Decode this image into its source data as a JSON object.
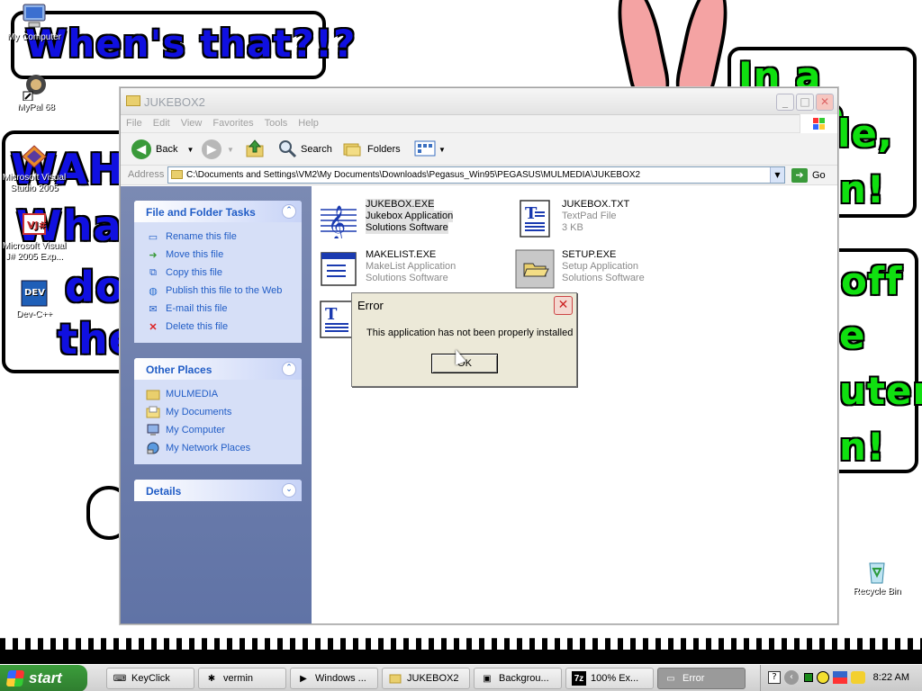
{
  "wallpaper": {
    "balloon_top_left": "When's that?!?",
    "balloon_left_lines": [
      "WAHU",
      "What",
      "do",
      "the"
    ],
    "balloon_right_lines": [
      "In a little",
      "le,",
      "n!"
    ],
    "balloon_right_bottom_lines": [
      "off",
      "e",
      "uter,",
      "n!"
    ]
  },
  "desktop_icons": [
    {
      "label": "My Computer"
    },
    {
      "label": "MyPal 68"
    },
    {
      "label": "Microsoft Visual Studio 2005"
    },
    {
      "label": "Microsoft Visual J# 2005 Exp..."
    },
    {
      "label": "Dev-C++"
    },
    {
      "label": "Recycle Bin"
    }
  ],
  "window": {
    "title": "JUKEBOX2",
    "menu": [
      "File",
      "Edit",
      "View",
      "Favorites",
      "Tools",
      "Help"
    ],
    "toolbar": {
      "back": "Back",
      "search": "Search",
      "folders": "Folders"
    },
    "address": {
      "label": "Address",
      "value": "C:\\Documents and Settings\\VM2\\My Documents\\Downloads\\Pegasus_Win95\\PEGASUS\\MULMEDIA\\JUKEBOX2",
      "go": "Go"
    },
    "file_tasks": {
      "title": "File and Folder Tasks",
      "items": [
        "Rename this file",
        "Move this file",
        "Copy this file",
        "Publish this file to the Web",
        "E-mail this file",
        "Delete this file"
      ]
    },
    "other_places": {
      "title": "Other Places",
      "items": [
        "MULMEDIA",
        "My Documents",
        "My Computer",
        "My Network Places"
      ]
    },
    "details": {
      "title": "Details"
    },
    "files": [
      {
        "name": "JUKEBOX.EXE",
        "line1": "Jukebox Application",
        "line2": "Solutions Software",
        "icon": "music-clef-icon"
      },
      {
        "name": "JUKEBOX.TXT",
        "line1": "TextPad File",
        "line2": "3 KB",
        "icon": "textpad-document-icon"
      },
      {
        "name": "MAKELIST.EXE",
        "line1": "MakeList Application",
        "line2": "Solutions Software",
        "icon": "window-app-icon"
      },
      {
        "name": "SETUP.EXE",
        "line1": "Setup Application",
        "line2": "Solutions Software",
        "icon": "open-folder-icon"
      },
      {
        "name": "",
        "line1": "",
        "line2": "",
        "icon": "textpad-document-icon"
      }
    ]
  },
  "dialog": {
    "title": "Error",
    "message": "This application has not been properly installed",
    "ok": "OK"
  },
  "taskbar": {
    "start": "start",
    "tasks": [
      {
        "label": "KeyClick"
      },
      {
        "label": "vermin"
      },
      {
        "label": "Windows ..."
      },
      {
        "label": "JUKEBOX2"
      },
      {
        "label": "Backgrou..."
      },
      {
        "label": "100% Ex..."
      },
      {
        "label": "Error"
      }
    ],
    "clock": "8:22 AM"
  }
}
